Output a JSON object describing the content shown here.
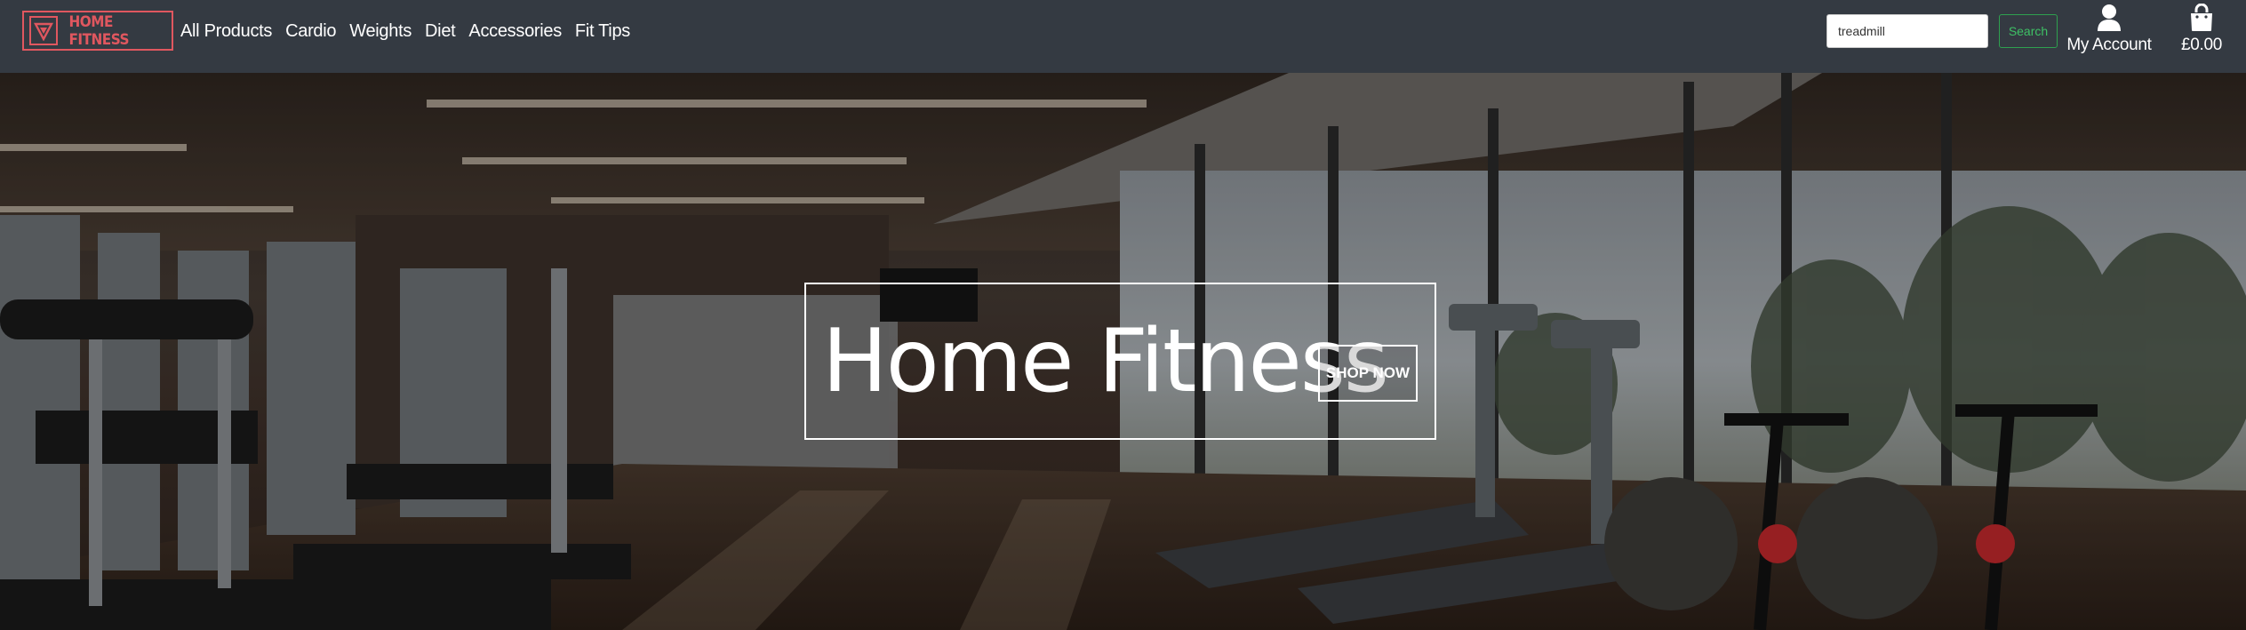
{
  "brand": {
    "name": "HOME FITNESS",
    "accent": "#e0575f"
  },
  "nav": {
    "links": [
      "All Products",
      "Cardio",
      "Weights",
      "Diet",
      "Accessories",
      "Fit Tips"
    ]
  },
  "search": {
    "value": "treadmill",
    "button_label": "Search",
    "button_color": "#3ec065"
  },
  "account": {
    "label": "My Account",
    "icon": "user-icon"
  },
  "cart": {
    "total": "£0.00",
    "icon": "shopping-bag-icon"
  },
  "hero": {
    "title": "Home Fitness",
    "cta_label": "SHOP NOW",
    "image": "gym-interior-with-treadmills-and-exercise-bikes"
  },
  "colors": {
    "navbar_bg": "#343a42",
    "hero_text": "#ffffff"
  }
}
